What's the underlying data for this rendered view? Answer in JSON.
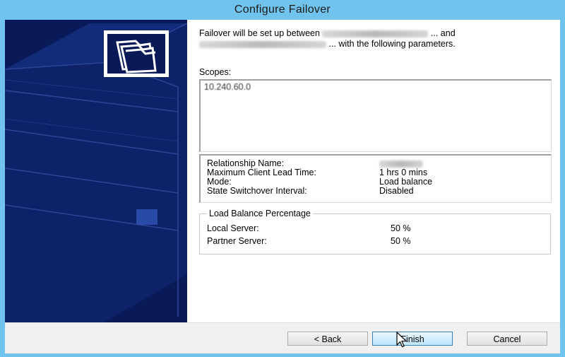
{
  "window": {
    "title": "Configure Failover"
  },
  "intro": {
    "line1_prefix": "Failover will be set up between",
    "line1_suffix": "... and",
    "line2_suffix": "... with the following parameters."
  },
  "scopes": {
    "label": "Scopes:",
    "items": [
      "10.240.60.0"
    ]
  },
  "parameters": [
    {
      "key": "Relationship Name:",
      "value": ""
    },
    {
      "key": "Maximum Client Lead Time:",
      "value": "1 hrs 0 mins"
    },
    {
      "key": "Mode:",
      "value": "Load balance"
    },
    {
      "key": "State Switchover Interval:",
      "value": "Disabled"
    }
  ],
  "load_balance": {
    "legend": "Load Balance Percentage",
    "local_label": "Local Server:",
    "local_value": "50 %",
    "partner_label": "Partner Server:",
    "partner_value": "50 %"
  },
  "buttons": {
    "back": "< Back",
    "finish": "Finish",
    "cancel": "Cancel"
  },
  "icons": {
    "banner_logo": "folders-icon",
    "cursor": "mouse-pointer-icon"
  },
  "colors": {
    "title_bar": "#6fc3ec",
    "banner": "#0a1a58"
  }
}
